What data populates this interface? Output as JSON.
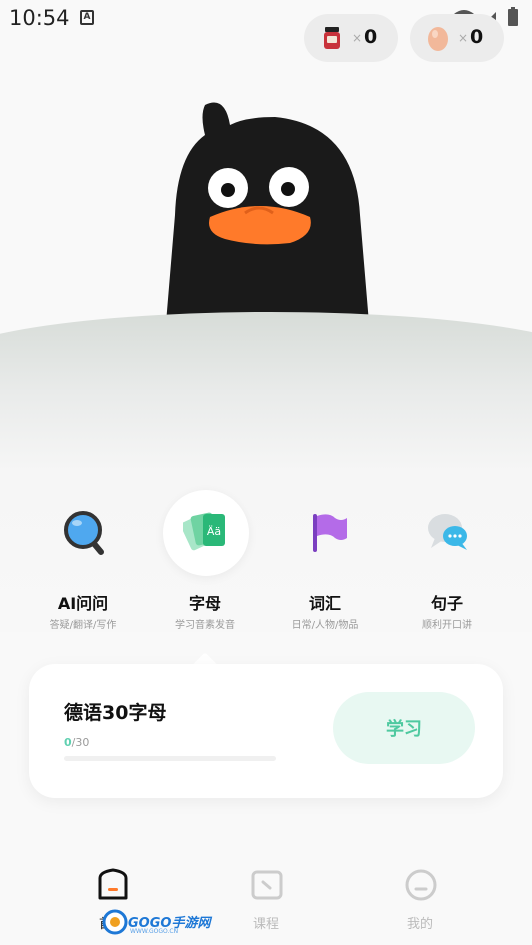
{
  "status_bar": {
    "time": "10:54",
    "notification_icon": "A"
  },
  "counters": [
    {
      "icon": "jam-jar-icon",
      "x_symbol": "×",
      "value": "0"
    },
    {
      "icon": "egg-icon",
      "x_symbol": "×",
      "value": "0"
    }
  ],
  "categories": [
    {
      "label": "AI问问",
      "sub": "答疑/翻译/写作",
      "icon": "magnifier-icon",
      "active": false
    },
    {
      "label": "字母",
      "sub": "学习音素发音",
      "icon": "letter-cards-icon",
      "active": true,
      "icon_text": "Ää"
    },
    {
      "label": "词汇",
      "sub": "日常/人物/物品",
      "icon": "flag-icon",
      "active": false
    },
    {
      "label": "句子",
      "sub": "顺利开口讲",
      "icon": "chat-bubbles-icon",
      "active": false
    }
  ],
  "card": {
    "title": "德语30字母",
    "progress_done": "0",
    "progress_total": "/30",
    "progress_fraction": 0,
    "button_label": "学习"
  },
  "nav": [
    {
      "label": "首页",
      "icon": "home-icon",
      "active": true
    },
    {
      "label": "课程",
      "icon": "course-icon",
      "active": false
    },
    {
      "label": "我的",
      "icon": "profile-icon",
      "active": false
    }
  ],
  "watermark": {
    "text": "GOGO手游网",
    "sub": "WWW.GOGO.CN"
  },
  "colors": {
    "accent": "#5fd0b0",
    "orange": "#ff7a2a",
    "mascot": "#1a1a1a"
  }
}
